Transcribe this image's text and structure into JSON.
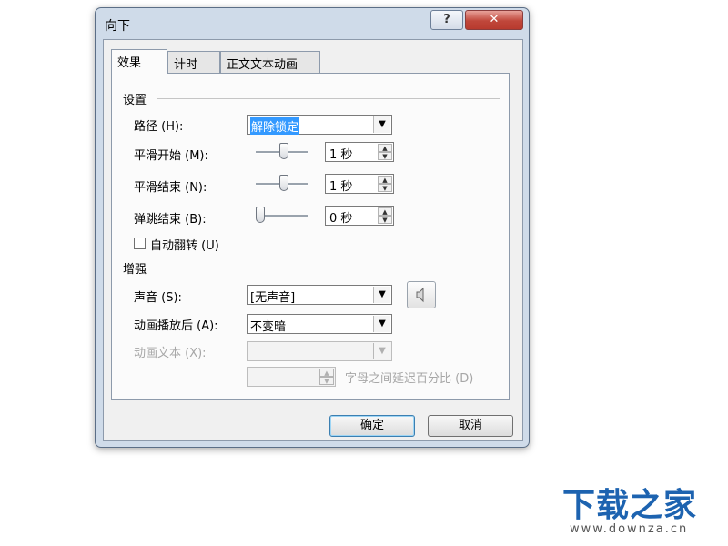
{
  "window": {
    "title": "向下",
    "help_label": "?",
    "close_label": "✕"
  },
  "tabs": [
    {
      "label": "效果",
      "active": true
    },
    {
      "label": "计时",
      "active": false
    },
    {
      "label": "正文文本动画",
      "active": false
    }
  ],
  "settings": {
    "section_label": "设置",
    "path": {
      "label": "路径 (H):",
      "value": "解除锁定"
    },
    "smooth_start": {
      "label": "平滑开始 (M):",
      "value": "1 秒",
      "slider_level": 0.55
    },
    "smooth_end": {
      "label": "平滑结束 (N):",
      "value": "1 秒",
      "slider_level": 0.55
    },
    "bounce_end": {
      "label": "弹跳结束 (B):",
      "value": "0 秒",
      "slider_level": 0.0
    },
    "auto_reverse": {
      "label": "自动翻转 (U)",
      "checked": false
    }
  },
  "enhance": {
    "section_label": "增强",
    "sound": {
      "label": "声音 (S):",
      "value": "[无声音]",
      "icon": "speaker-icon"
    },
    "after_animation": {
      "label": "动画播放后 (A):",
      "value": "不变暗"
    },
    "animate_text": {
      "label": "动画文本 (X):",
      "value": ""
    },
    "delay": {
      "value": "",
      "suffix": "字母之间延迟百分比 (D)"
    }
  },
  "buttons": {
    "ok": "确定",
    "cancel": "取消"
  },
  "watermark": {
    "logo": "下载之家",
    "url": "www.downza.cn"
  },
  "colors": {
    "selection": "#3399ff",
    "brand": "#1d63b0"
  }
}
